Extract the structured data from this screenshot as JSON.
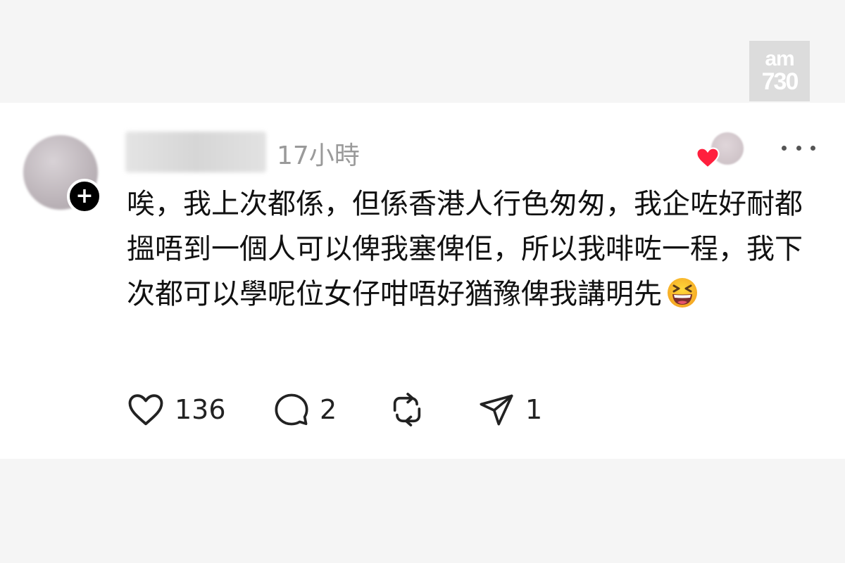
{
  "watermark": {
    "line1": "am",
    "line2": "730"
  },
  "post": {
    "timestamp": "17小時",
    "text": "唉，我上次都係，但係香港人行色匆匆，￼我企咗好耐都搵唔到一個人可以俾我塞俾佢，所以我￼啡咗一程，我下次都可以學呢位女仔咁唔好猶豫￼俾我講明先",
    "emoji": "grinning-squinting-face"
  },
  "actions": {
    "likes": "136",
    "replies": "2",
    "shares": "1"
  },
  "colors": {
    "heart": "#ff1f3d",
    "text": "#111111",
    "muted": "#9a9a9a",
    "background": "#f5f5f5"
  }
}
